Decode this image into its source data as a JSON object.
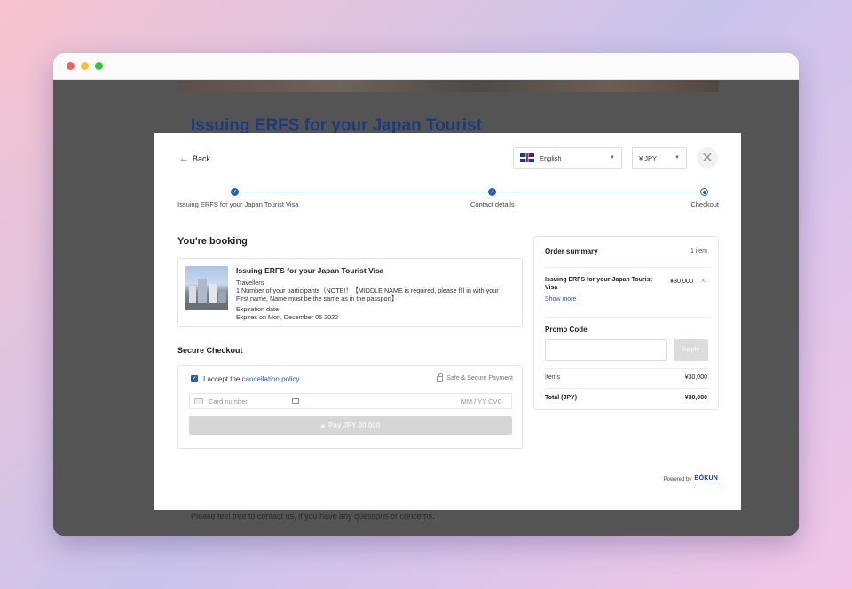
{
  "background_page": {
    "title": "Issuing ERFS for your Japan Tourist",
    "footer_text": "Please feel free to contact us, if you have any questions or concerns."
  },
  "header": {
    "back_label": "Back",
    "language": "English",
    "currency": "¥ JPY"
  },
  "steps": [
    {
      "label": "Issuing ERFS for your Japan Tourist Visa",
      "state": "done"
    },
    {
      "label": "Contact details",
      "state": "done"
    },
    {
      "label": "Checkout",
      "state": "current"
    }
  ],
  "booking": {
    "heading": "You're booking",
    "title": "Issuing ERFS for your Japan Tourist Visa",
    "travellers_label": "Travellers",
    "travellers_line1": "1 Number of your participants（NOTE!！【MIDDLE NAME is required, please fill in with your",
    "travellers_line2": "First name, Name must be the same as in the passport】",
    "expiration_label": "Expiration date",
    "expiration_value": "Expires on Mon, December 05 2022"
  },
  "checkout": {
    "heading": "Secure Checkout",
    "accept_prefix": "I accept the ",
    "policy_link": "cancellation policy",
    "safe_label": "Safe & Secure Payment",
    "card_placeholder": "Card number",
    "exp_cvc_placeholder": "MM / YY  CVC",
    "pay_label": "Pay JPY 30,000"
  },
  "summary": {
    "title": "Order summary",
    "count": "1 item",
    "item_name": "Issuing ERFS for your Japan Tourist Visa",
    "item_price": "¥30,000",
    "show_more": "Show more",
    "promo_label": "Promo Code",
    "apply_label": "Apply",
    "items_label": "Items",
    "items_value": "¥30,000",
    "total_label": "Total (JPY)",
    "total_value": "¥30,000"
  },
  "powered_by": {
    "label": "Powered by",
    "brand": "BÓKUN"
  }
}
